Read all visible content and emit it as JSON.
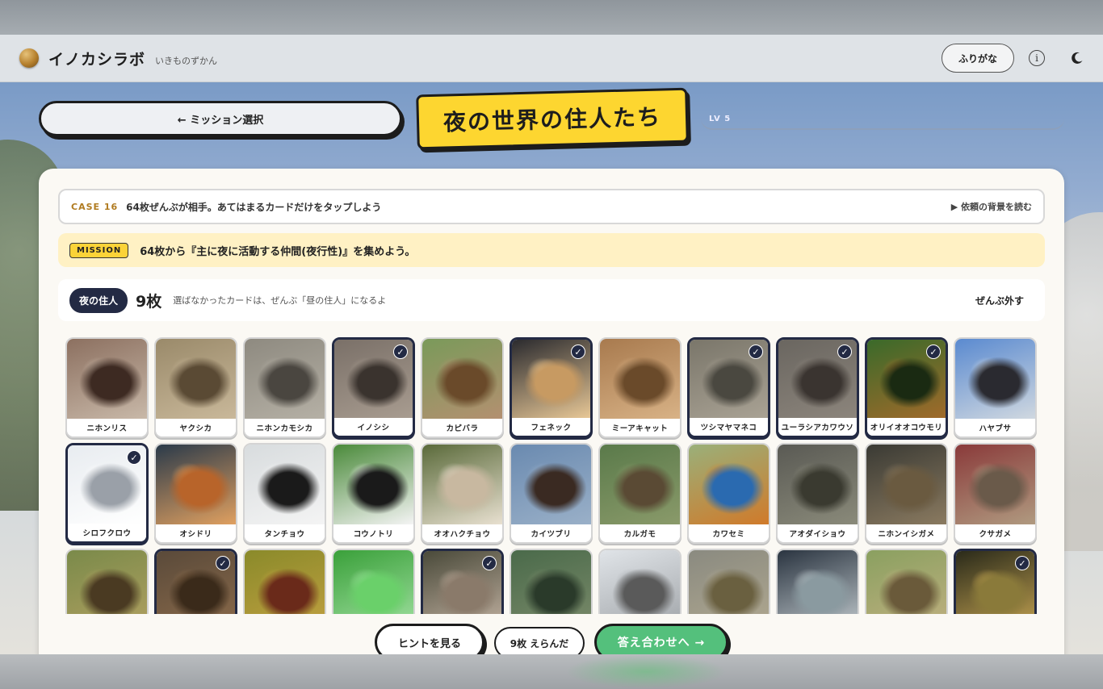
{
  "app": {
    "brand": "イノカシラボ",
    "subtitle": "いきものずかん",
    "furigana_label": "ふりがな",
    "info_glyph": "i"
  },
  "nav": {
    "back_label": "← ミッション選択",
    "mission_title": "夜の世界の住人たち",
    "level_label": "LV 5"
  },
  "case": {
    "tag": "CASE 16",
    "text": "64枚ぜんぶが相手。あてはまるカードだけをタップしよう",
    "background_link": "▶ 依頼の背景を読む"
  },
  "mission": {
    "tag": "MISSION",
    "text": "64枚から『主に夜に活動する仲間(夜行性)』を集めよう。"
  },
  "selection": {
    "group_label": "夜の住人",
    "count": "9枚",
    "note": "選ばなかったカードは、ぜんぶ「昼の住人」になるよ",
    "clear_label": "ぜんぶ外す"
  },
  "check_glyph": "✓",
  "cards": [
    {
      "name": "ニホンリス",
      "selected": false,
      "c1": "#8c7060",
      "c2": "#3d2a22",
      "c3": "#c8b8a8"
    },
    {
      "name": "ヤクシカ",
      "selected": false,
      "c1": "#9a8a6a",
      "c2": "#5a4a34",
      "c3": "#c9b89a"
    },
    {
      "name": "ニホンカモシカ",
      "selected": false,
      "c1": "#8e8a80",
      "c2": "#4a4640",
      "c3": "#b5b0a5"
    },
    {
      "name": "イノシシ",
      "selected": true,
      "c1": "#7a7068",
      "c2": "#3a332e",
      "c3": "#a89c90"
    },
    {
      "name": "カピバラ",
      "selected": false,
      "c1": "#7a9a5a",
      "c2": "#6a4a2a",
      "c3": "#b39070"
    },
    {
      "name": "フェネック",
      "selected": true,
      "c1": "#2a2a2e",
      "c2": "#c79a62",
      "c3": "#e7c796"
    },
    {
      "name": "ミーアキャット",
      "selected": false,
      "c1": "#a87a4e",
      "c2": "#6a4a2a",
      "c3": "#d8b286"
    },
    {
      "name": "ツシマヤマネコ",
      "selected": true,
      "c1": "#7a766a",
      "c2": "#4a4840",
      "c3": "#a9a294"
    },
    {
      "name": "ユーラシアカワウソ",
      "selected": true,
      "c1": "#6a6660",
      "c2": "#3a3430",
      "c3": "#8c857c"
    },
    {
      "name": "オリイオオコウモリ",
      "selected": true,
      "c1": "#3a6a2a",
      "c2": "#1a2a12",
      "c3": "#a06a2a"
    },
    {
      "name": "ハヤブサ",
      "selected": false,
      "c1": "#5a8ad0",
      "c2": "#2a2a30",
      "c3": "#d0d8e0"
    },
    {
      "name": "シロフクロウ",
      "selected": true,
      "c1": "#e8ecf0",
      "c2": "#9aa0a8",
      "c3": "#ffffff"
    },
    {
      "name": "オシドリ",
      "selected": false,
      "c1": "#2a3a4a",
      "c2": "#b8642a",
      "c3": "#e0a060"
    },
    {
      "name": "タンチョウ",
      "selected": false,
      "c1": "#d8dcde",
      "c2": "#1a1a1a",
      "c3": "#f4f4f4"
    },
    {
      "name": "コウノトリ",
      "selected": false,
      "c1": "#4a8a3a",
      "c2": "#1a1a1a",
      "c3": "#f4f4f4"
    },
    {
      "name": "オオハクチョウ",
      "selected": false,
      "c1": "#5a6a3a",
      "c2": "#c8b8a0",
      "c3": "#e8e0d0"
    },
    {
      "name": "カイツブリ",
      "selected": false,
      "c1": "#6a8ab0",
      "c2": "#3a2a22",
      "c3": "#9ab0c8"
    },
    {
      "name": "カルガモ",
      "selected": false,
      "c1": "#5a7a4a",
      "c2": "#5a4a34",
      "c3": "#8a9a6a"
    },
    {
      "name": "カワセミ",
      "selected": false,
      "c1": "#9ab07a",
      "c2": "#2a6ab0",
      "c3": "#d07a2a"
    },
    {
      "name": "アオダイショウ",
      "selected": false,
      "c1": "#5a5a54",
      "c2": "#3a3a30",
      "c3": "#8a8a7a"
    },
    {
      "name": "ニホンイシガメ",
      "selected": false,
      "c1": "#3a3a34",
      "c2": "#6a5a40",
      "c3": "#8a7a60"
    },
    {
      "name": "クサガメ",
      "selected": false,
      "c1": "#8a3a3a",
      "c2": "#6a5a4a",
      "c3": "#b09a80"
    },
    {
      "name": "",
      "selected": false,
      "c1": "#7a8a4a",
      "c2": "#4a3a22",
      "c3": "#b0a060"
    },
    {
      "name": "",
      "selected": true,
      "c1": "#5a4a3a",
      "c2": "#3a2a1a",
      "c3": "#8a6a4a"
    },
    {
      "name": "",
      "selected": false,
      "c1": "#8a8a2a",
      "c2": "#6a2a1a",
      "c3": "#c0a040"
    },
    {
      "name": "",
      "selected": false,
      "c1": "#3aa03a",
      "c2": "#6ad06a",
      "c3": "#a0e0a0"
    },
    {
      "name": "",
      "selected": true,
      "c1": "#4a4a3a",
      "c2": "#8a7a6a",
      "c3": "#c0b0a0"
    },
    {
      "name": "",
      "selected": false,
      "c1": "#4a6a4a",
      "c2": "#2a3a2a",
      "c3": "#7a8a6a"
    },
    {
      "name": "",
      "selected": false,
      "c1": "#e0e4e8",
      "c2": "#5a5a5a",
      "c3": "#a0a4a8"
    },
    {
      "name": "",
      "selected": false,
      "c1": "#8a8a80",
      "c2": "#6a6040",
      "c3": "#b0a890"
    },
    {
      "name": "",
      "selected": false,
      "c1": "#2a3440",
      "c2": "#8a9aa0",
      "c3": "#c0c8cc"
    },
    {
      "name": "",
      "selected": false,
      "c1": "#8aa060",
      "c2": "#6a5a3a",
      "c3": "#c0b080"
    },
    {
      "name": "",
      "selected": true,
      "c1": "#2a2a1a",
      "c2": "#8a7a3a",
      "c3": "#c0a050"
    }
  ],
  "footer": {
    "hint_label": "ヒントを見る",
    "selected_count_label": "9枚 えらんだ",
    "answer_label": "答え合わせへ →"
  }
}
